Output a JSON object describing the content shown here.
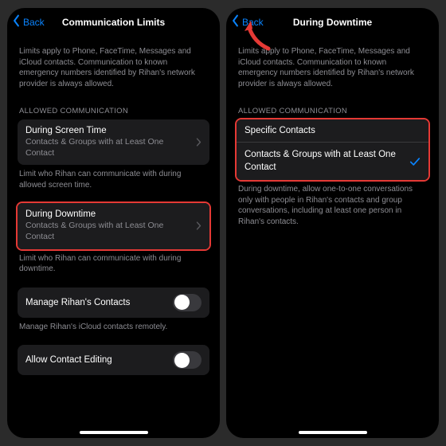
{
  "left": {
    "back": "Back",
    "title": "Communication Limits",
    "intro": "Limits apply to Phone, FaceTime, Messages and iCloud contacts. Communication to known emergency numbers identified by Rihan's network provider is always allowed.",
    "sectionHeader": "ALLOWED COMMUNICATION",
    "row1": {
      "title": "During Screen Time",
      "sub": "Contacts & Groups with at Least One Contact"
    },
    "footer1": "Limit who Rihan can communicate with during allowed screen time.",
    "row2": {
      "title": "During Downtime",
      "sub": "Contacts & Groups with at Least One Contact"
    },
    "footer2": "Limit who Rihan can communicate with during downtime.",
    "row3": {
      "title": "Manage Rihan's Contacts"
    },
    "footer3": "Manage Rihan's iCloud contacts remotely.",
    "row4": {
      "title": "Allow Contact Editing"
    }
  },
  "right": {
    "back": "Back",
    "title": "During Downtime",
    "intro": "Limits apply to Phone, FaceTime, Messages and iCloud contacts. Communication to known emergency numbers identified by Rihan's network provider is always allowed.",
    "sectionHeader": "ALLOWED COMMUNICATION",
    "opt1": "Specific Contacts",
    "opt2": "Contacts & Groups with at Least One Contact",
    "footer": "During downtime, allow one-to-one conversations only with people in Rihan's contacts and group conversations, including at least one person in Rihan's contacts."
  }
}
